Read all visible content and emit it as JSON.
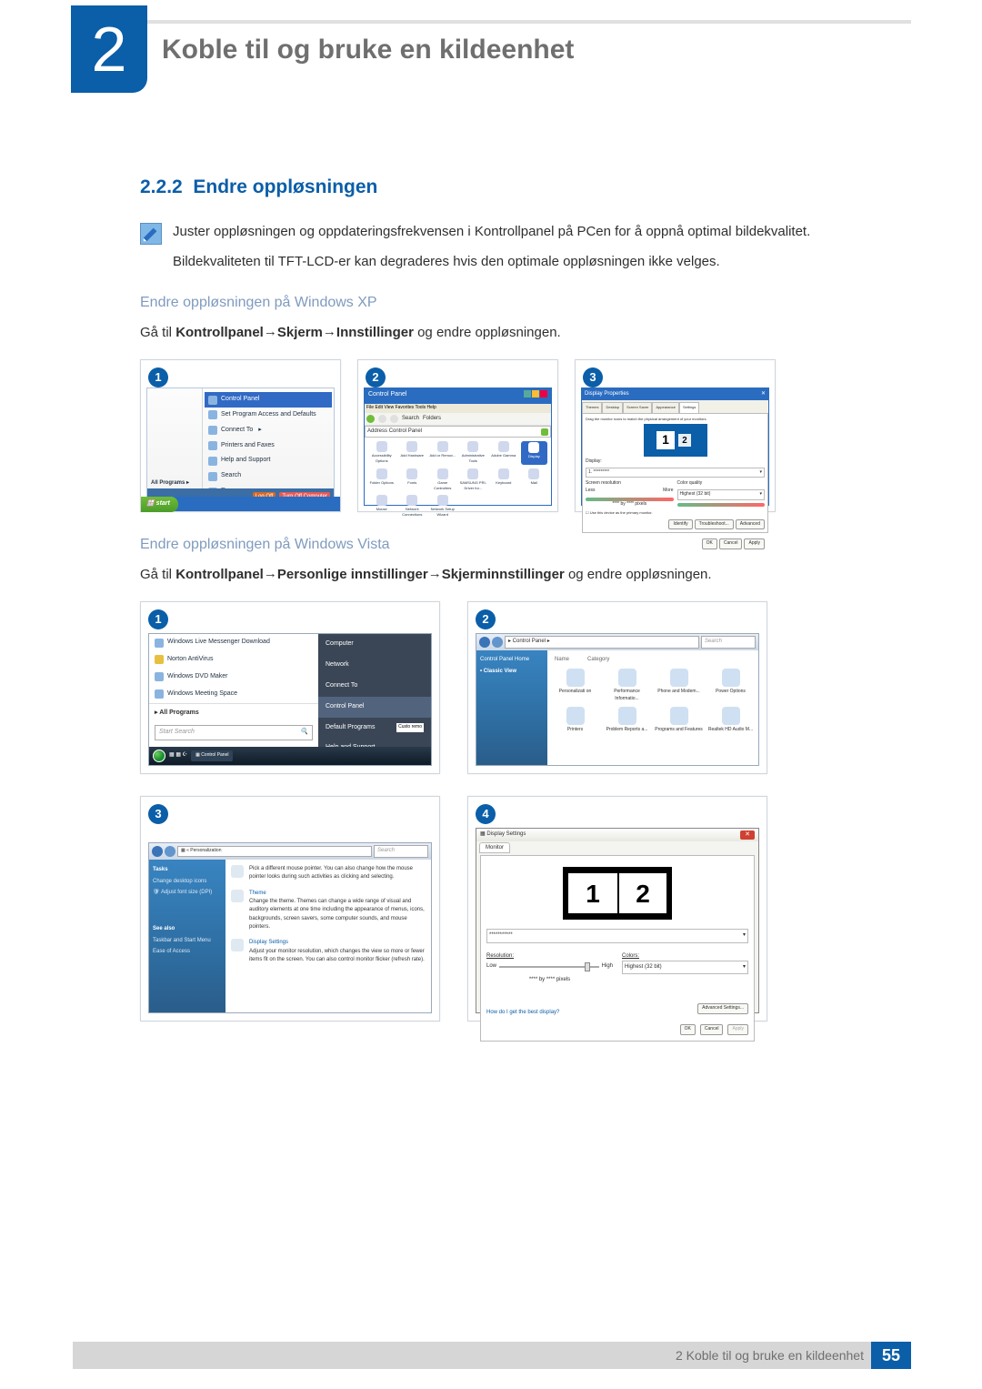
{
  "chapter": {
    "number": "2",
    "title": "Koble til og bruke en kildeenhet"
  },
  "section": {
    "number": "2.2.2",
    "title": "Endre oppløsningen"
  },
  "note": {
    "line1": "Juster oppløsningen og oppdateringsfrekvensen i Kontrollpanel på PCen for å oppnå optimal bildekvalitet.",
    "line2": "Bildekvaliteten til TFT-LCD-er kan degraderes hvis den optimale oppløsningen ikke velges."
  },
  "xp": {
    "heading": "Endre oppløsningen på Windows XP",
    "instruction_pre": "Gå til ",
    "path1": "Kontrollpanel",
    "arrow": " → ",
    "path2": "Skjerm",
    "path3": "Innstillinger",
    "instruction_post": " og endre oppløsningen.",
    "badge1": "1",
    "badge2": "2",
    "badge3": "3",
    "start": "start",
    "all_programs": "All Programs",
    "menu": {
      "cp": "Control Panel",
      "spa": "Set Program Access and Defaults",
      "connect": "Connect To",
      "printers": "Printers and Faxes",
      "help": "Help and Support",
      "search": "Search",
      "run": "Run..."
    },
    "logoff": "Log Off",
    "turnoff": "Turn Off Computer",
    "cp": {
      "title": "Control Panel",
      "menu_items": "File   Edit   View   Favorites   Tools   Help",
      "search": "Search",
      "folders": "Folders",
      "addr": "Address",
      "addr_val": "Control Panel",
      "icons": [
        "Accessibility Options",
        "Add Hardware",
        "Add or Remov...",
        "Administrative Tools",
        "Adobe Gamma",
        "Display",
        "Folder Options",
        "Fonts",
        "Game Controllers",
        "SAMSUNG PRI-Driver for...",
        "Keyboard",
        "Mail",
        "Mouse",
        "Network Connections",
        "Network Setup Wizard"
      ]
    },
    "dp": {
      "title": "Display Properties",
      "tabs": [
        "Themes",
        "Desktop",
        "Screen Saver",
        "Appearance",
        "Settings"
      ],
      "hint": "Drag the monitor icons to match the physical arrangement of your monitors.",
      "display": "Display:",
      "disp_val": "1. *********",
      "res": "Screen resolution",
      "less": "Less",
      "more": "More",
      "cq": "Color quality",
      "cq_val": "Highest (32 bit)",
      "px": "**** by **** pixels",
      "chk": "☐ Use this device as the primary monitor.",
      "identify": "Identify",
      "trouble": "Troubleshoot...",
      "adv": "Advanced",
      "ok": "OK",
      "cancel": "Cancel",
      "apply": "Apply",
      "m1": "1",
      "m2": "2"
    }
  },
  "vista": {
    "heading": "Endre oppløsningen på Windows Vista",
    "instruction_pre": "Gå til ",
    "path1": "Kontrollpanel",
    "path2": "Personlige innstillinger",
    "path3": "Skjerminnstillinger",
    "instruction_post": " og endre oppløsningen.",
    "badge1": "1",
    "badge2": "2",
    "badge3": "3",
    "badge4": "4",
    "start_menu": {
      "m1": "Windows Live Messenger Download",
      "m2": "Norton AntiVirus",
      "m3": "Windows DVD Maker",
      "m4": "Windows Meeting Space",
      "ap": "All Programs",
      "search": "Start Search",
      "r1": "Computer",
      "r2": "Network",
      "r3": "Connect To",
      "r4": "Control Panel",
      "r5": "Default Programs",
      "r6": "Help and Support",
      "custo": "Custo remo",
      "task_cp": "Control Panel"
    },
    "cp": {
      "path": "▸ Control Panel ▸",
      "search": "Search",
      "home": "Control Panel Home",
      "classic": "Classic View",
      "hdr_name": "Name",
      "hdr_cat": "Category",
      "icons": [
        "Personalizati on",
        "Performance Informatio...",
        "Phone and Modem...",
        "Power Options",
        "Printers",
        "Problem Reports a...",
        "Programs and Features",
        "Realtek HD Audio M..."
      ]
    },
    "pz": {
      "path": "« Personalization",
      "tasks": "Tasks",
      "t1": "Change desktop icons",
      "t2": "Adjust font size (DPI)",
      "see": "See also",
      "s1": "Taskbar and Start Menu",
      "s2": "Ease of Access",
      "mouse_hdr": "",
      "mouse_txt": "Pick a different mouse pointer. You can also change how the mouse pointer looks during such activities as clicking and selecting.",
      "theme_hdr": "Theme",
      "theme_txt": "Change the theme. Themes can change a wide range of visual and auditory elements at one time including the appearance of menus, icons, backgrounds, screen savers, some computer sounds, and mouse pointers.",
      "ds_hdr": "Display Settings",
      "ds_txt": "Adjust your monitor resolution, which changes the view so more or fewer items fit on the screen. You can also control monitor flicker (refresh rate)."
    },
    "ds": {
      "title": "Display Settings",
      "tab": "Monitor",
      "m1": "1",
      "m2": "2",
      "drop": "***********",
      "res": "Resolution:",
      "col": "Colors:",
      "low": "Low",
      "high": "High",
      "col_val": "Highest (32 bit)",
      "px": "**** by **** pixels",
      "link": "How do I get the best display?",
      "adv": "Advanced Settings...",
      "ok": "OK",
      "cancel": "Cancel",
      "apply": "Apply"
    }
  },
  "footer": {
    "text": "2 Koble til og bruke en kildeenhet",
    "page": "55"
  }
}
